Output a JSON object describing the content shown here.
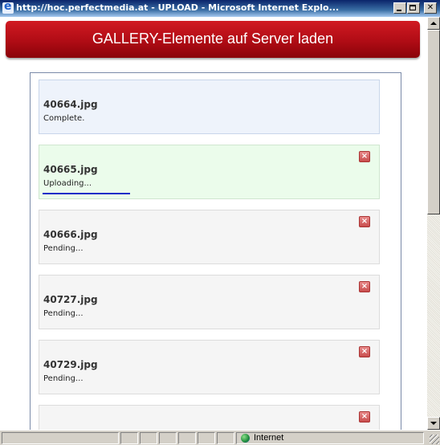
{
  "window": {
    "title": "http://hoc.perfectmedia.at - UPLOAD - Microsoft Internet Explo...",
    "buttons": [
      "minimize",
      "maximize",
      "close"
    ]
  },
  "banner": {
    "title": "GALLERY-Elemente auf Server laden",
    "color": "#b00c15"
  },
  "uploads": [
    {
      "file": "40664.jpg",
      "status": "Complete.",
      "state": "complete"
    },
    {
      "file": "40665.jpg",
      "status": "Uploading...",
      "state": "uploading",
      "progress": 0.27
    },
    {
      "file": "40666.jpg",
      "status": "Pending...",
      "state": "pending"
    },
    {
      "file": "40727.jpg",
      "status": "Pending...",
      "state": "pending"
    },
    {
      "file": "40729.jpg",
      "status": "Pending...",
      "state": "pending"
    },
    {
      "file": "",
      "status": "",
      "state": "pending"
    }
  ],
  "statusbar": {
    "zone": "Internet",
    "zone_icon": "globe-icon"
  },
  "icons": {
    "cancel": "cancel-x-icon",
    "app": "internet-explorer-icon"
  }
}
